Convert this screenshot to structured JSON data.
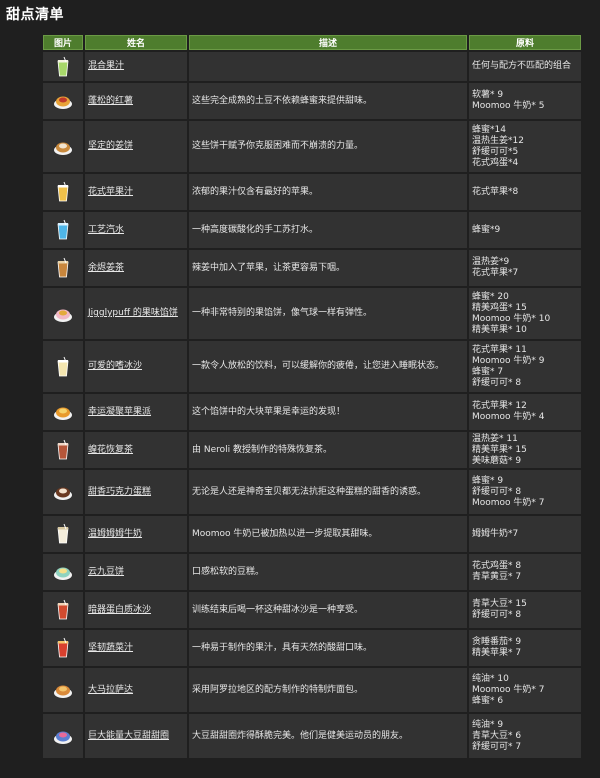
{
  "page_title": "甜点清单",
  "headers": {
    "image": "图片",
    "name": "姓名",
    "desc": "描述",
    "ingredients": "原料"
  },
  "rows": [
    {
      "icon": "smoothie-cup-icon",
      "color": "#a8d86a",
      "accent": "#f3f3e0",
      "name": "混合果汁",
      "desc": "",
      "ingredients": [
        "任何与配方不匹配的组合"
      ]
    },
    {
      "icon": "baked-sweet-potato-icon",
      "color": "#e7a237",
      "accent": "#c0392b",
      "name": "蓬松的红薯",
      "desc": "这些完全成熟的土豆不依赖蜂蜜来提供甜味。",
      "ingredients": [
        "软薯* 9",
        "Moomoo 牛奶* 5"
      ]
    },
    {
      "icon": "ginger-cookie-icon",
      "color": "#c98a3d",
      "accent": "#f1e4cf",
      "name": "坚定的姜饼",
      "desc": "这些饼干赋予你克服困难而不崩溃的力量。",
      "ingredients": [
        "蜂蜜*14",
        "温热生姜*12",
        "舒缓可可*5",
        "花式鸡蛋*4"
      ]
    },
    {
      "icon": "apple-juice-icon",
      "color": "#f0c14a",
      "accent": "#ffffff",
      "name": "花式苹果汁",
      "desc": "浓郁的果汁仅含有最好的苹果。",
      "ingredients": [
        "花式苹果*8"
      ]
    },
    {
      "icon": "soda-icon",
      "color": "#4fb6e8",
      "accent": "#d8f1ff",
      "name": "工艺汽水",
      "desc": "一种高度碳酸化的手工苏打水。",
      "ingredients": [
        "蜂蜜*9"
      ]
    },
    {
      "icon": "ginger-tea-icon",
      "color": "#c8863c",
      "accent": "#e9d3a8",
      "name": "余烬姜茶",
      "desc": "辣姜中加入了苹果，让茶更容易下咽。",
      "ingredients": [
        "温热姜*9",
        "花式苹果*7"
      ]
    },
    {
      "icon": "jiggly-pie-icon",
      "color": "#f2b8c6",
      "accent": "#e3aa3c",
      "name": "Jigglypuff 的果味馅饼",
      "desc": "一种非常特别的果馅饼，像气球一样有弹性。",
      "ingredients": [
        "蜂蜜* 20",
        "精美鸡蛋* 15",
        "Moomoo 牛奶* 10",
        "精美苹果* 10"
      ]
    },
    {
      "icon": "shake-icon",
      "color": "#f4e6b0",
      "accent": "#ffffff",
      "name": "可爱的嗜冰沙",
      "desc": "一款令人放松的饮料，可以缓解你的疲倦，让您进入睡眠状态。",
      "ingredients": [
        "花式苹果* 11",
        "Moomoo 牛奶* 9",
        "蜂蜜* 7",
        "舒缓可可* 8"
      ]
    },
    {
      "icon": "apple-pie-icon",
      "color": "#e89a2c",
      "accent": "#f6d36b",
      "name": "幸运凝聚苹果派",
      "desc": "这个馅饼中的大块苹果是幸运的发现！",
      "ingredients": [
        "花式苹果* 12",
        "Moomoo 牛奶* 4"
      ]
    },
    {
      "icon": "herbal-tea-icon",
      "color": "#b5563a",
      "accent": "#f0d8c8",
      "name": "蝗花恢复茶",
      "desc": "由 Neroli 教授制作的特殊恢复茶。",
      "ingredients": [
        "温热姜* 11",
        "精美苹果* 15",
        "美味蘑菇* 9"
      ]
    },
    {
      "icon": "chocolate-cake-icon",
      "color": "#6b3a22",
      "accent": "#f3e2cf",
      "name": "甜香巧克力蛋糕",
      "desc": "无论是人还是神奇宝贝都无法抗拒这种蛋糕的甜香的诱惑。",
      "ingredients": [
        "蜂蜜* 9",
        "舒缓可可* 8",
        "Moomoo 牛奶* 7"
      ]
    },
    {
      "icon": "milk-glass-icon",
      "color": "#f5eedc",
      "accent": "#d8c8a0",
      "name": "温姆姆姆牛奶",
      "desc": "Moomoo 牛奶已被加热以进一步提取其甜味。",
      "ingredients": [
        "姆姆牛奶*7"
      ]
    },
    {
      "icon": "pancake-icon",
      "color": "#8fd3c0",
      "accent": "#f6e08a",
      "name": "云九豆饼",
      "desc": "口感松软的豆糕。",
      "ingredients": [
        "花式鸡蛋* 8",
        "青草黄豆* 7"
      ]
    },
    {
      "icon": "protein-shake-icon",
      "color": "#d24b2f",
      "accent": "#f2d5b8",
      "name": "暗器蛋白质冰沙",
      "desc": "训练结束后喝一杯这种甜冰沙是一种享受。",
      "ingredients": [
        "青草大豆* 15",
        "舒缓可可* 8"
      ]
    },
    {
      "icon": "veggie-juice-icon",
      "color": "#d8402e",
      "accent": "#f4c66b",
      "name": "坚韧蔬菜汁",
      "desc": "一种易于制作的果汁，具有天然的酸甜口味。",
      "ingredients": [
        "贪睡番茄* 9",
        "精美苹果* 7"
      ]
    },
    {
      "icon": "malasada-icon",
      "color": "#d98a3a",
      "accent": "#f2c36b",
      "name": "大马拉萨达",
      "desc": "采用阿罗拉地区的配方制作的特制炸面包。",
      "ingredients": [
        "纯油* 10",
        "Moomoo 牛奶* 7",
        "蜂蜜* 6"
      ]
    },
    {
      "icon": "donut-icon",
      "color": "#5b7fd1",
      "accent": "#e86a9a",
      "name": "巨大能量大豆甜甜圈",
      "desc": "大豆甜甜圈炸得酥脆完美。他们是健美运动员的朋友。",
      "ingredients": [
        "纯油* 9",
        "青草大豆* 6",
        "舒缓可可* 7"
      ]
    }
  ]
}
